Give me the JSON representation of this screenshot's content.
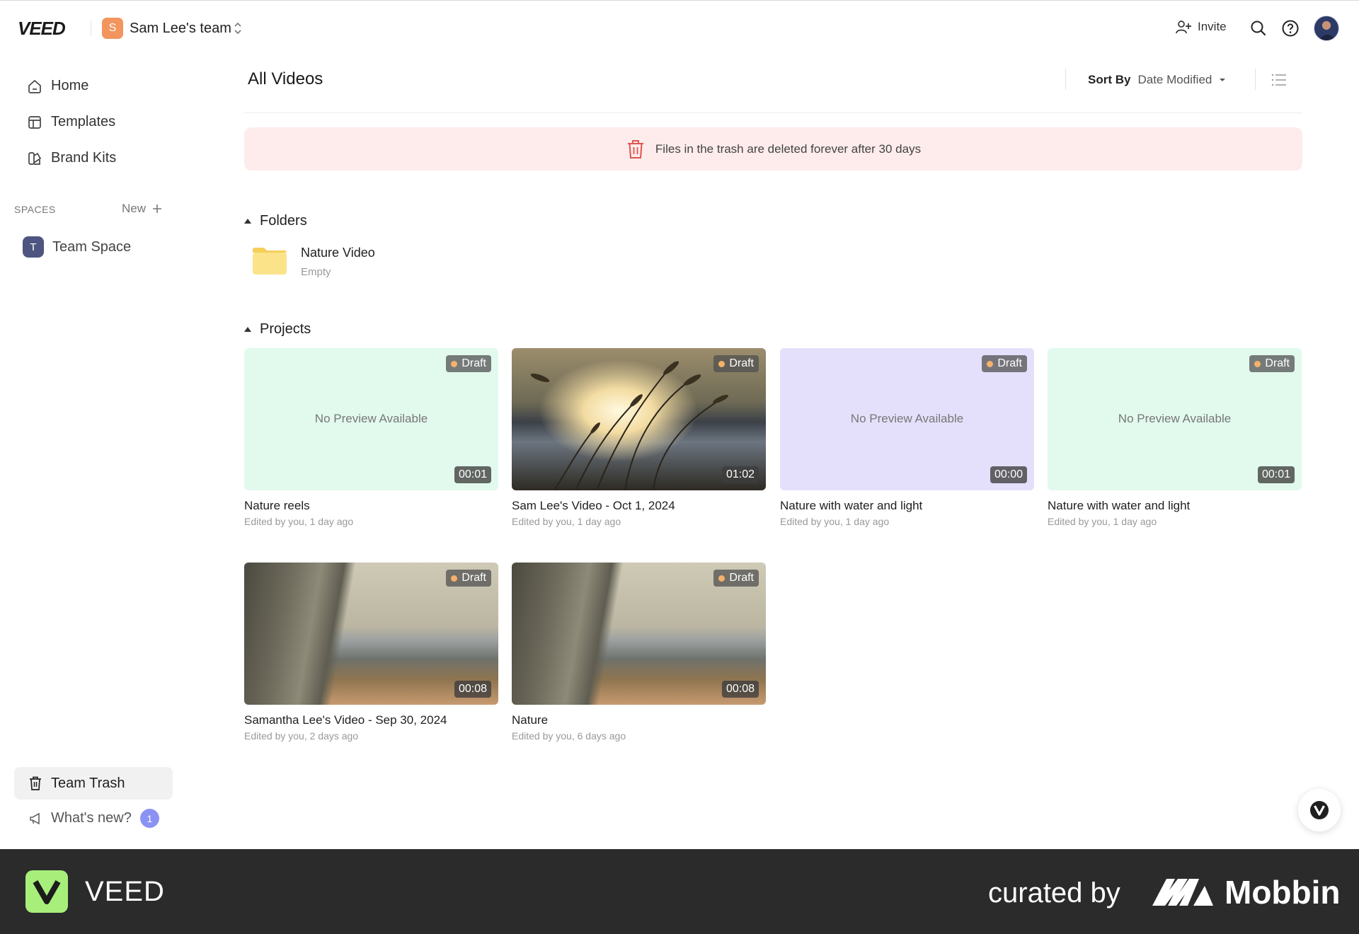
{
  "header": {
    "logo": "VEED",
    "team_initial": "S",
    "team_name": "Sam Lee's team",
    "invite_label": "Invite"
  },
  "sidebar": {
    "nav": [
      {
        "label": "Home",
        "icon": "home-icon"
      },
      {
        "label": "Templates",
        "icon": "templates-icon"
      },
      {
        "label": "Brand Kits",
        "icon": "brand-kits-icon"
      }
    ],
    "spaces_label": "SPACES",
    "new_label": "New",
    "space": {
      "initial": "T",
      "label": "Team Space"
    },
    "trash_label": "Team Trash",
    "whats_new_label": "What's new?",
    "whats_new_count": "1"
  },
  "main": {
    "title": "All Videos",
    "sort_label": "Sort By",
    "sort_value": "Date Modified",
    "trash_notice": "Files in the trash are deleted forever after 30 days",
    "folders_heading": "Folders",
    "folder": {
      "title": "Nature Video",
      "subtitle": "Empty"
    },
    "projects_heading": "Projects",
    "no_preview_text": "No Preview Available",
    "draft_label": "Draft",
    "projects": [
      {
        "title": "Nature reels",
        "edited": "Edited by you, 1 day ago",
        "duration": "00:01",
        "thumb": "mint"
      },
      {
        "title": "Sam Lee's Video - Oct 1, 2024",
        "edited": "Edited by you, 1 day ago",
        "duration": "01:02",
        "thumb": "field"
      },
      {
        "title": "Nature with water and light",
        "edited": "Edited by you, 1 day ago",
        "duration": "00:00",
        "thumb": "lavender"
      },
      {
        "title": "Nature with water and light",
        "edited": "Edited by you, 1 day ago",
        "duration": "00:01",
        "thumb": "mint"
      },
      {
        "title": "Samantha Lee's Video - Sep 30, 2024",
        "edited": "Edited by you, 2 days ago",
        "duration": "00:08",
        "thumb": "cliff"
      },
      {
        "title": "Nature",
        "edited": "Edited by you, 6 days ago",
        "duration": "00:08",
        "thumb": "cliff"
      }
    ]
  },
  "footer": {
    "brand": "VEED",
    "curated_by": "curated by",
    "mobbin": "Mobbin"
  },
  "colors": {
    "accent": "#8a93f3",
    "team_avatar": "#f2955e",
    "banner_bg": "#fdeceb",
    "trash_icon": "#e0554f",
    "footer_bg": "#2b2b2b",
    "footer_logo": "#a7ef7a"
  }
}
